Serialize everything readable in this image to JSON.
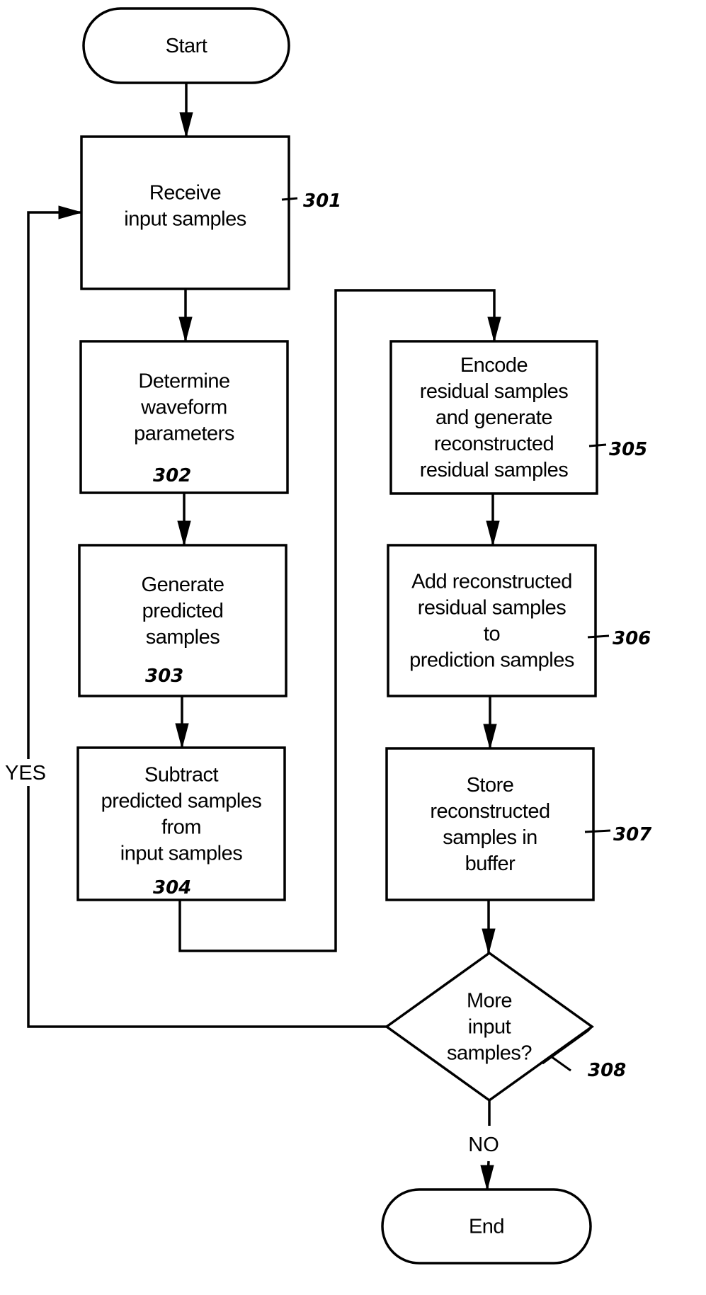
{
  "diagram": {
    "type": "flowchart",
    "nodes": [
      {
        "id": "start",
        "shape": "terminal",
        "lines": [
          "Start"
        ],
        "ref": ""
      },
      {
        "id": "n301",
        "shape": "process",
        "lines": [
          "Receive",
          "input samples"
        ],
        "ref": "301"
      },
      {
        "id": "n302",
        "shape": "process",
        "lines": [
          "Determine",
          "waveform",
          "parameters"
        ],
        "ref": "302"
      },
      {
        "id": "n303",
        "shape": "process",
        "lines": [
          "Generate",
          "predicted",
          "samples"
        ],
        "ref": "303"
      },
      {
        "id": "n304",
        "shape": "process",
        "lines": [
          "Subtract",
          "predicted samples",
          "from",
          "input samples"
        ],
        "ref": "304"
      },
      {
        "id": "n305",
        "shape": "process",
        "lines": [
          "Encode",
          "residual samples",
          "and generate",
          "reconstructed",
          "residual samples"
        ],
        "ref": "305"
      },
      {
        "id": "n306",
        "shape": "process",
        "lines": [
          "Add reconstructed",
          "residual samples",
          "to",
          "prediction samples"
        ],
        "ref": "306"
      },
      {
        "id": "n307",
        "shape": "process",
        "lines": [
          "Store",
          "reconstructed",
          "samples in",
          "buffer"
        ],
        "ref": "307"
      },
      {
        "id": "n308",
        "shape": "decision",
        "lines": [
          "More",
          "input",
          "samples?"
        ],
        "ref": "308"
      },
      {
        "id": "end",
        "shape": "terminal",
        "lines": [
          "End"
        ],
        "ref": ""
      }
    ],
    "edges": [
      {
        "from": "start",
        "to": "n301",
        "label": ""
      },
      {
        "from": "n301",
        "to": "n302",
        "label": ""
      },
      {
        "from": "n302",
        "to": "n303",
        "label": ""
      },
      {
        "from": "n303",
        "to": "n304",
        "label": ""
      },
      {
        "from": "n304",
        "to": "n305",
        "label": ""
      },
      {
        "from": "n305",
        "to": "n306",
        "label": ""
      },
      {
        "from": "n306",
        "to": "n307",
        "label": ""
      },
      {
        "from": "n307",
        "to": "n308",
        "label": ""
      },
      {
        "from": "n308",
        "to": "n301",
        "label": "YES"
      },
      {
        "from": "n308",
        "to": "end",
        "label": "NO"
      }
    ]
  }
}
